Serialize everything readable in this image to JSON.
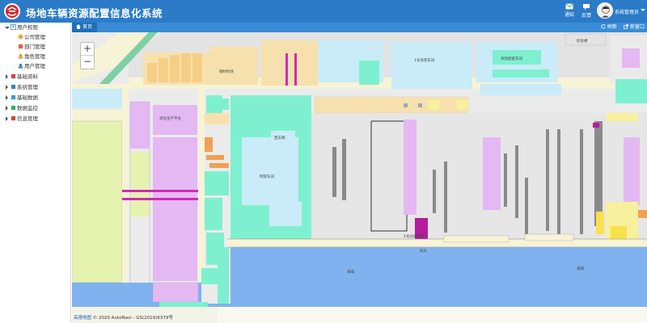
{
  "header": {
    "title": "场地车辆资源配置信息化系统",
    "notify_label": "通知",
    "feedback_label": "反馈",
    "user_name": "系统管理员"
  },
  "sidebar": {
    "items": [
      {
        "label": "用户权限",
        "expanded": true,
        "icon": "user-shield-icon"
      },
      {
        "label": "公司管理",
        "icon": "company-icon"
      },
      {
        "label": "部门管理",
        "icon": "department-icon"
      },
      {
        "label": "角色管理",
        "icon": "role-icon"
      },
      {
        "label": "用户管理",
        "icon": "user-icon"
      },
      {
        "label": "基础资料",
        "icon": "basic-data-icon"
      },
      {
        "label": "系统管理",
        "icon": "system-icon"
      },
      {
        "label": "基础数据",
        "icon": "data-icon"
      },
      {
        "label": "数据监控",
        "icon": "monitor-icon"
      },
      {
        "label": "信息管理",
        "icon": "info-icon"
      }
    ]
  },
  "tabs": {
    "home": "首页",
    "refresh": "刷新",
    "new_window": "新窗口"
  },
  "map": {
    "attribution_brand": "高德地图",
    "attribution_text": "© 2020 AutoNavi - GS(2019)6379号",
    "labels": {
      "sea_south": "海域",
      "sea_mid": "海域",
      "shed": "钢材料场",
      "plant": "制管车间",
      "west_shop": "西东网",
      "north_shop": "1号涂装车间",
      "paint_shop": "涂装配套车间",
      "office": "综合楼",
      "platform_w": "涂化生产平台",
      "platform_c": "1号分段平台",
      "dock": "码头"
    },
    "colors": {
      "sea": "#7fb2ee",
      "road": "#f6f3d6",
      "green": "#7ff0cf",
      "purple": "#e4b8f3",
      "yellow": "#f7f09d",
      "magenta": "#b21d9c"
    }
  }
}
